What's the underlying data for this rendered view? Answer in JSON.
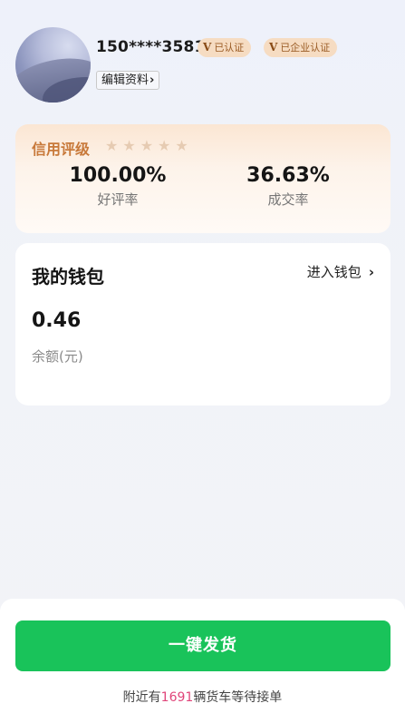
{
  "profile": {
    "phone": "150****3581",
    "badges": [
      {
        "icon": "V",
        "label": "已认证"
      },
      {
        "icon": "V",
        "label": "已企业认证"
      }
    ],
    "edit_label": "编辑资料",
    "edit_chevron": "›"
  },
  "credit": {
    "title": "信用评级",
    "stars": "★★★★★",
    "rating_stars": 0,
    "stats": [
      {
        "value": "100.00%",
        "label": "好评率"
      },
      {
        "value": "36.63%",
        "label": "成交率"
      }
    ]
  },
  "wallet": {
    "title": "我的钱包",
    "link_label": "进入钱包",
    "link_chevron": "›",
    "balance": "0.46",
    "balance_label": "余额(元)"
  },
  "action": {
    "ship_label": "一键发货",
    "nearby_prefix": "附近有",
    "nearby_count": "1691",
    "nearby_suffix": "辆货车等待接单"
  },
  "colors": {
    "accent_green": "#19c35a",
    "highlight_pink": "#e0457a",
    "badge_bg": "#f6dcc2",
    "credit_title": "#c8793a"
  }
}
